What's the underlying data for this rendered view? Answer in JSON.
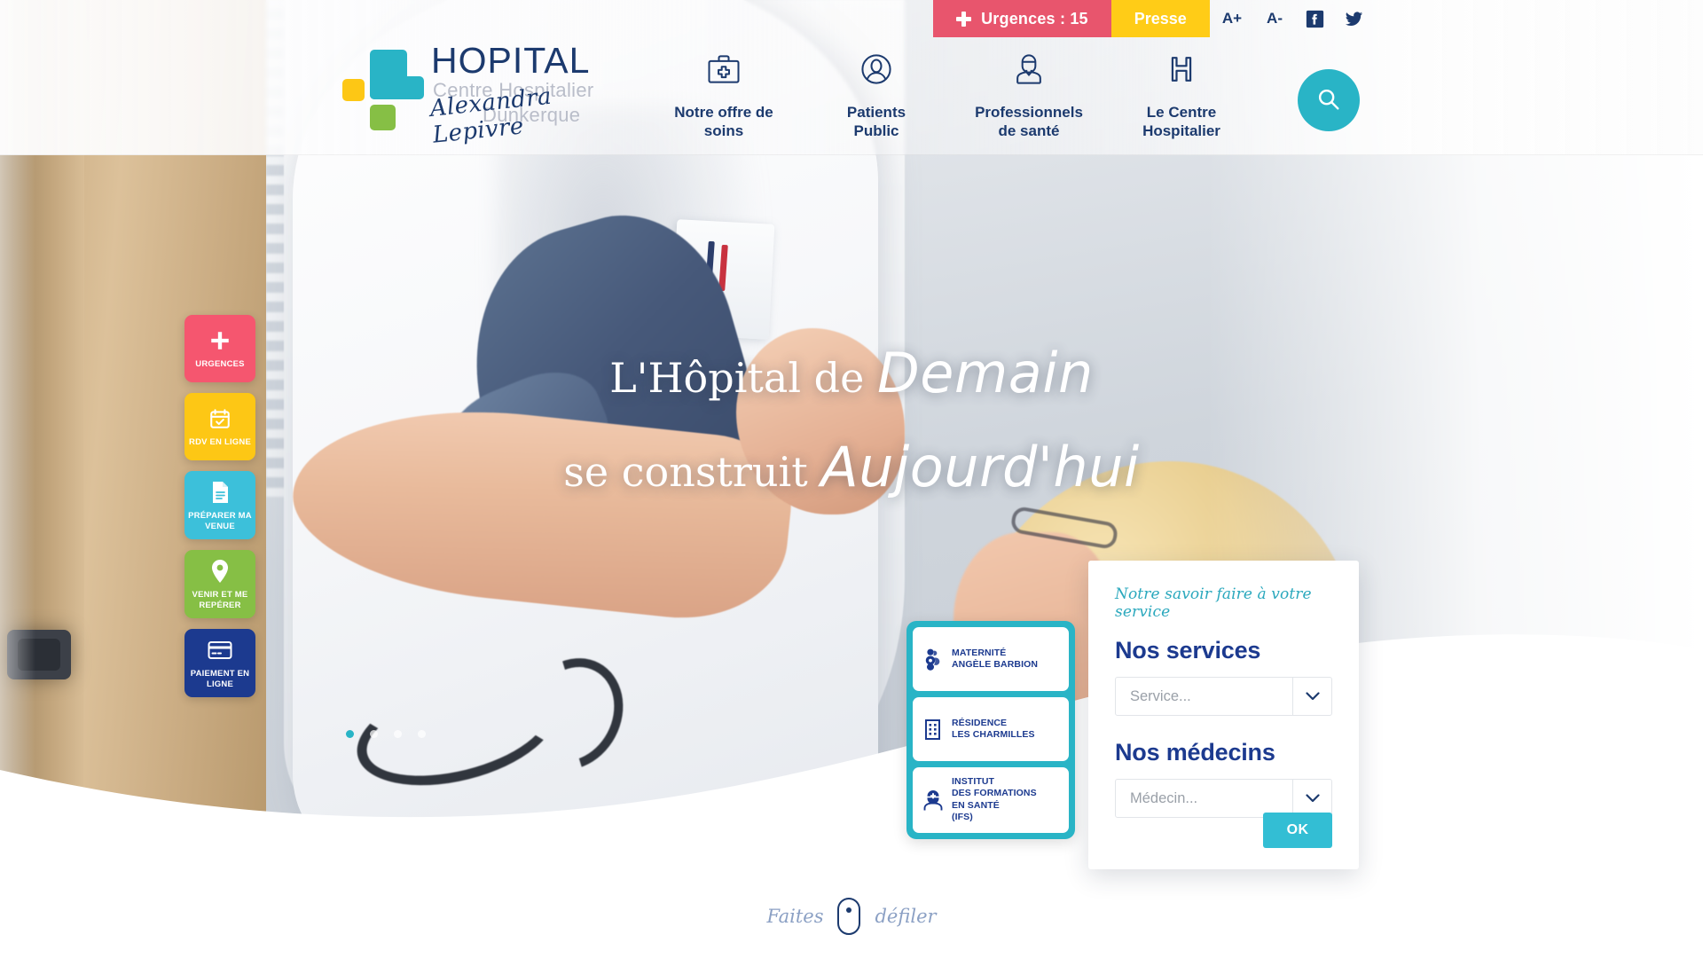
{
  "topbar": {
    "urgences": {
      "label": "Urgences : 15",
      "icon": "plus-cross-icon",
      "color": "#e8556d"
    },
    "presse": {
      "label": "Presse",
      "color": "#ffcc17"
    },
    "font_bigger": "A+",
    "font_smaller": "A-",
    "facebook_icon": "facebook-icon",
    "twitter_icon": "twitter-icon"
  },
  "logo": {
    "title": "HOPITAL",
    "subtitle": "Centre Hospitalier",
    "script": "Alexandra Lepivre",
    "city": "Dunkerque",
    "mark_colors": {
      "teal": "#29b4c6",
      "yellow": "#fdc715",
      "green": "#86bf45"
    }
  },
  "nav": {
    "items": [
      {
        "label": "Notre offre de\nsoins",
        "icon": "medical-bag-icon"
      },
      {
        "label": "Patients\nPublic",
        "icon": "user-circle-icon"
      },
      {
        "label": "Professionnels\nde santé",
        "icon": "doctor-icon"
      },
      {
        "label": "Le Centre\nHospitalier",
        "icon": "letter-h-icon"
      }
    ],
    "search_icon": "search-icon",
    "search_color": "#29b4c6"
  },
  "quick_access": [
    {
      "label": "URGENCES",
      "icon": "plus-cross-icon",
      "color": "#f5566f",
      "class": "q-red"
    },
    {
      "label": "RDV EN LIGNE",
      "icon": "calendar-check-icon",
      "color": "#fdc715",
      "class": "q-yellow"
    },
    {
      "label": "PRÉPARER MA\nVENUE",
      "icon": "document-icon",
      "color": "#3cc0da",
      "class": "q-cyan"
    },
    {
      "label": "VENIR ET ME\nREPÉRER",
      "icon": "map-pin-icon",
      "color": "#86bf45",
      "class": "q-green"
    },
    {
      "label": "PAIEMENT EN\nLIGNE",
      "icon": "credit-card-icon",
      "color": "#1c3a8f",
      "class": "q-navy"
    }
  ],
  "hero": {
    "line1_plain": "L'Hôpital de ",
    "line1_script": "Demain",
    "line2_plain": "se construit ",
    "line2_script": "Aujourd'hui",
    "dots_total": 4,
    "dot_active_index": 0
  },
  "tiles": [
    {
      "label": "MATERNITÉ\nANGÈLE BARBION",
      "icon": "baby-icon"
    },
    {
      "label": "RÉSIDENCE\nLES CHARMILLES",
      "icon": "building-icon"
    },
    {
      "label": "INSTITUT\nDES FORMATIONS\nEN SANTÉ\n(IFS)",
      "icon": "nurse-icon"
    }
  ],
  "card": {
    "kicker": "Notre savoir faire à votre service",
    "services_heading": "Nos services",
    "services_placeholder": "Service...",
    "doctors_heading": "Nos médecins",
    "doctors_placeholder": "Médecin...",
    "ok_label": "OK",
    "accent": "#33bed4"
  },
  "scroll_hint": {
    "before": "Faites",
    "after": "défiler",
    "icon": "mouse-icon"
  }
}
